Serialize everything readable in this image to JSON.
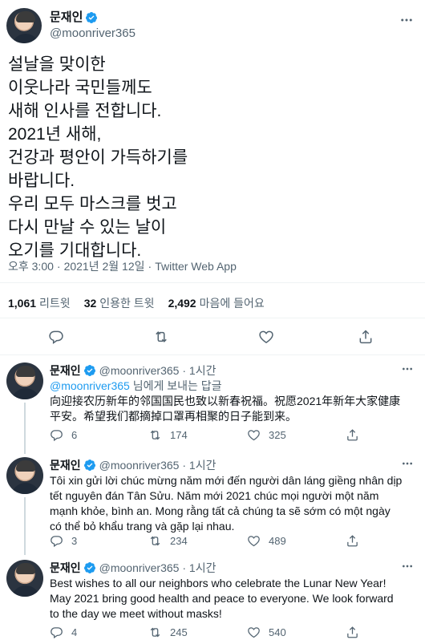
{
  "main_tweet": {
    "name": "문재인",
    "handle": "@moonriver365",
    "text": "설날을 맞이한\n이웃나라 국민들께도\n새해 인사를 전합니다.\n2021년 새해,\n건강과 평안이 가득하기를\n바랍니다.\n우리 모두 마스크를 벗고\n다시 만날 수 있는 날이\n오기를 기대합니다.",
    "time": "오후 3:00",
    "date": "2021년 2월 12일",
    "sep": "·",
    "source": "Twitter Web App",
    "stats": {
      "retweets_count": "1,061",
      "retweets_label": "리트윗",
      "quotes_count": "32",
      "quotes_label": "인용한 트윗",
      "likes_count": "2,492",
      "likes_label": "마음에 들어요"
    },
    "more_icon": "more-icon"
  },
  "replies": [
    {
      "name": "문재인",
      "handle": "@moonriver365",
      "sep": " · ",
      "time": "1시간",
      "replying_handle": "@moonriver365",
      "replying_suffix": " 님에게 보내는 답글",
      "text": "向迎接农历新年的邻国国民也致以新春祝福。祝愿2021年新年大家健康平安。希望我们都摘掉口罩再相聚的日子能到来。",
      "replies": "6",
      "retweets": "174",
      "likes": "325"
    },
    {
      "name": "문재인",
      "handle": "@moonriver365",
      "sep": " · ",
      "time": "1시간",
      "text": "Tôi xin gửi lời chúc mừng năm mới đến người dân láng giềng nhân dịp tết nguyên đán Tân Sửu. Năm mới 2021 chúc mọi người một năm mạnh khỏe, bình an. Mong rằng tất cả chúng ta sẽ sớm có một ngày có thể bỏ khẩu trang và gặp lại nhau.",
      "replies": "3",
      "retweets": "234",
      "likes": "489"
    },
    {
      "name": "문재인",
      "handle": "@moonriver365",
      "sep": " · ",
      "time": "1시간",
      "text": "Best wishes to all our neighbors who celebrate the Lunar New Year! May 2021 bring good health and peace to everyone. We look forward to the day we meet without masks!",
      "replies": "4",
      "retweets": "245",
      "likes": "540"
    }
  ],
  "colors": {
    "accent": "#1d9bf0",
    "text": "#0f1419",
    "secondary": "#536471",
    "divider": "#eff3f4"
  }
}
